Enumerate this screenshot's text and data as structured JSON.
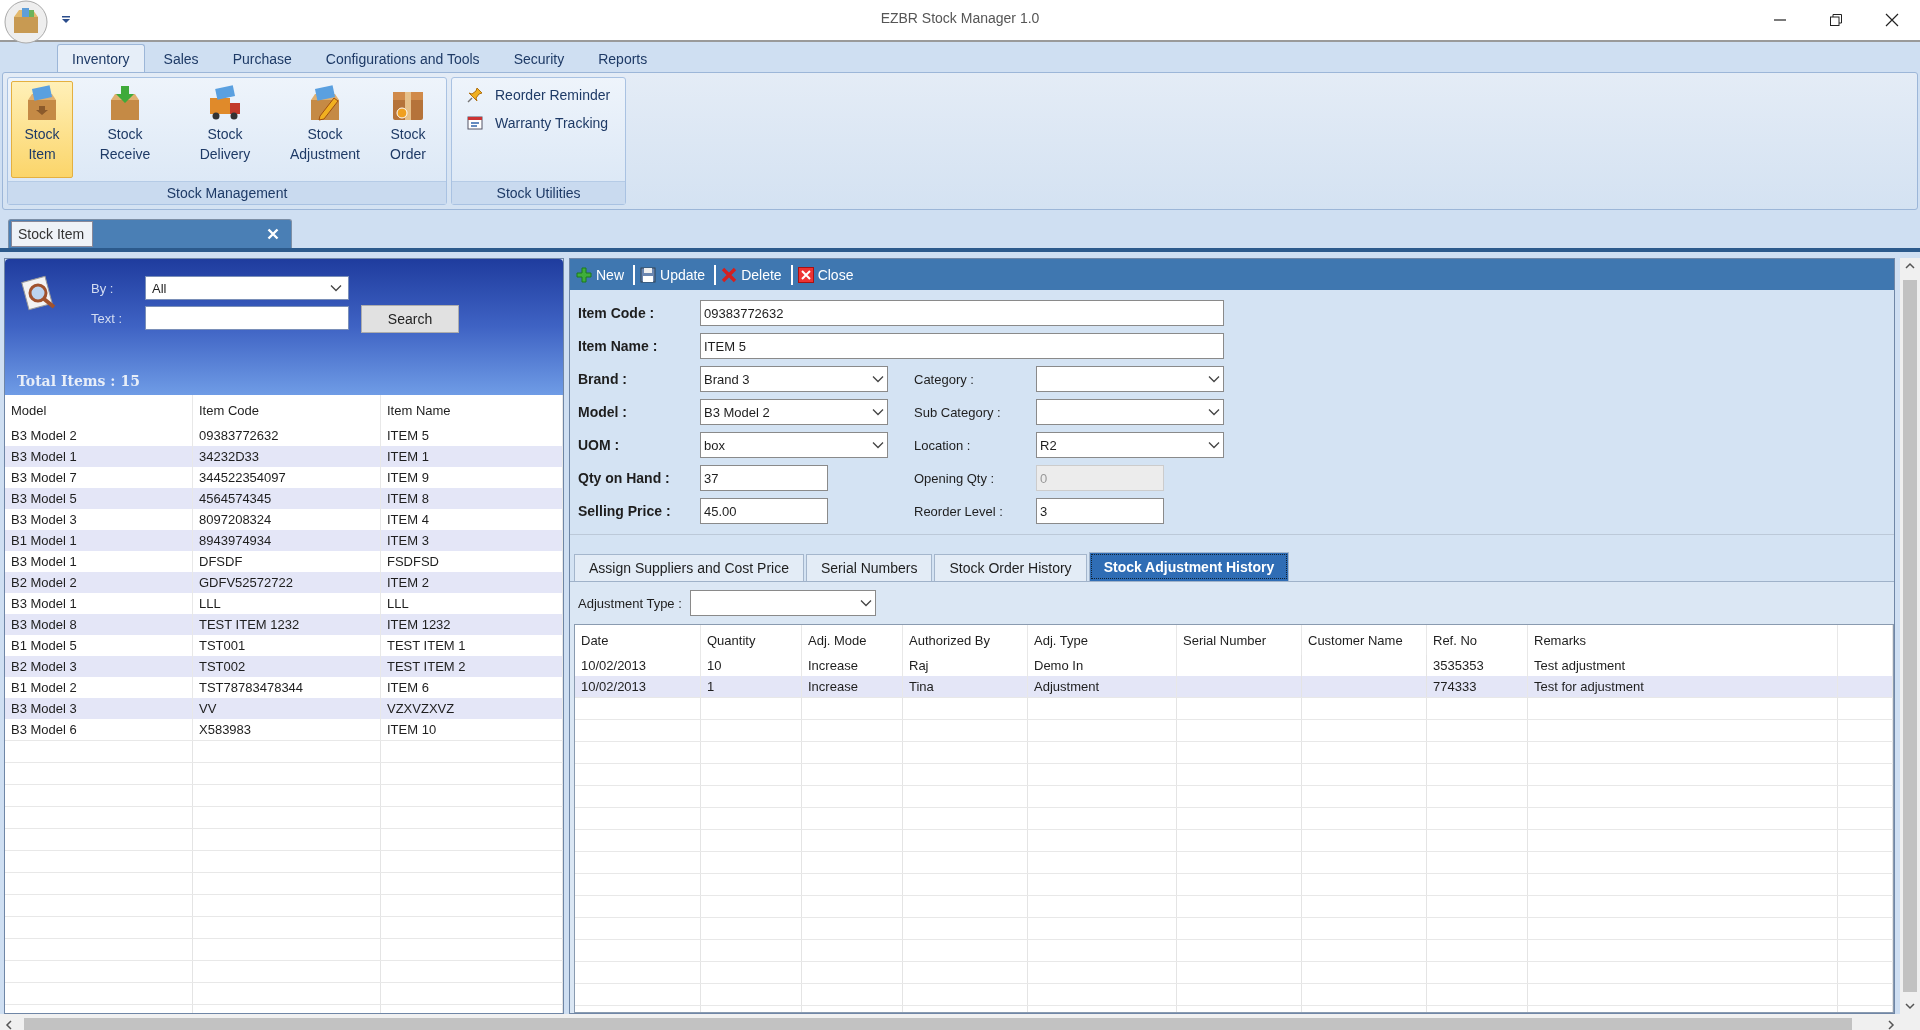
{
  "window": {
    "title": "EZBR Stock Manager 1.0"
  },
  "ribbon": {
    "tabs": [
      {
        "label": "Inventory",
        "selected": true
      },
      {
        "label": "Sales",
        "selected": false
      },
      {
        "label": "Purchase",
        "selected": false
      },
      {
        "label": "Configurations and Tools",
        "selected": false
      },
      {
        "label": "Security",
        "selected": false
      },
      {
        "label": "Reports",
        "selected": false
      }
    ],
    "groups": [
      {
        "title": "Stock Management",
        "kind": "large",
        "items": [
          {
            "label": "Stock Item",
            "selected": true
          },
          {
            "label": "Stock Receive",
            "selected": false
          },
          {
            "label": "Stock Delivery",
            "selected": false
          },
          {
            "label": "Stock Adjustment",
            "selected": false
          },
          {
            "label": "Stock Order",
            "selected": false
          }
        ]
      },
      {
        "title": "Stock Utilities",
        "kind": "small",
        "items": [
          {
            "label": "Reorder Reminder",
            "selected": false
          },
          {
            "label": "Warranty Tracking",
            "selected": false
          }
        ]
      }
    ]
  },
  "document_tabs": [
    {
      "label": "Stock Item",
      "selected": true
    }
  ],
  "search": {
    "by_label": "By :",
    "by_value": "All",
    "text_label": "Text :",
    "button": "Search",
    "total": "Total Items : 15"
  },
  "items_table": {
    "columns": [
      "Model",
      "Item Code",
      "Item Name"
    ],
    "rows": [
      [
        "B3 Model 2",
        "09383772632",
        "ITEM 5"
      ],
      [
        "B3 Model 1",
        "34232D33",
        "ITEM 1"
      ],
      [
        "B3 Model 7",
        "344522354097",
        "ITEM 9"
      ],
      [
        "B3 Model 5",
        "4564574345",
        "ITEM 8"
      ],
      [
        "B3 Model 3",
        "8097208324",
        "ITEM 4"
      ],
      [
        "B1 Model 1",
        "8943974934",
        "ITEM 3"
      ],
      [
        "B3 Model 1",
        "DFSDF",
        "FSDFSD"
      ],
      [
        "B2 Model 2",
        "GDFV52572722",
        "ITEM 2"
      ],
      [
        "B3 Model 1",
        "LLL",
        "LLL"
      ],
      [
        "B3 Model 8",
        "TEST ITEM 1232",
        "ITEM 1232"
      ],
      [
        "B1 Model 5",
        "TST001",
        "TEST ITEM 1"
      ],
      [
        "B2 Model 3",
        "TST002",
        "TEST ITEM 2"
      ],
      [
        "B1 Model 2",
        "TST78783478344",
        "ITEM 6"
      ],
      [
        "B3 Model 3",
        "VV",
        "VZXVZXVZ"
      ],
      [
        "B3 Model 6",
        "X583983",
        "ITEM 10"
      ]
    ]
  },
  "toolbar": [
    "New",
    "Update",
    "Delete",
    "Close"
  ],
  "form": {
    "rows": [
      [
        {
          "label": "Item Code :",
          "value": "09383772632",
          "kind": "text"
        }
      ],
      [
        {
          "label": "Item Name :",
          "value": "ITEM 5",
          "kind": "text"
        }
      ],
      [
        {
          "label": "Brand :",
          "value": "Brand 3",
          "kind": "combo"
        },
        {
          "label": "Category :",
          "kind": "combo"
        }
      ],
      [
        {
          "label": "Model :",
          "value": "B3 Model 2",
          "kind": "combo"
        },
        {
          "label": "Sub Category :",
          "kind": "combo"
        }
      ],
      [
        {
          "label": "UOM :",
          "value": "box",
          "kind": "combo"
        },
        {
          "label": "Location :",
          "value": "R2",
          "kind": "combo"
        }
      ],
      [
        {
          "label": "Qty on Hand :",
          "value": "37",
          "kind": "text"
        },
        {
          "label": "Opening Qty :",
          "value": "0",
          "kind": "text",
          "disabled": true
        }
      ],
      [
        {
          "label": "Selling Price :",
          "value": "45.00",
          "kind": "text"
        },
        {
          "label": "Reorder Level :",
          "value": "3",
          "kind": "text",
          "disabled": false
        }
      ]
    ]
  },
  "detail_tabs": [
    {
      "label": "Assign Suppliers and Cost Price",
      "selected": false
    },
    {
      "label": "Serial Numbers",
      "selected": false
    },
    {
      "label": "Stock Order History",
      "selected": false
    },
    {
      "label": "Stock Adjustment History",
      "selected": true
    }
  ],
  "adjustment_type": {
    "label": "Adjustment Type :"
  },
  "history_table": {
    "columns": [
      "Date",
      "Quantity",
      "Adj. Mode",
      "Authorized By",
      "Adj. Type",
      "Serial Number",
      "Customer Name",
      "Ref. No",
      "Remarks"
    ],
    "rows": [
      [
        "10/02/2013",
        "10",
        "Increase",
        "Raj",
        "Demo In",
        "",
        "",
        "3535353",
        "Test adjustment"
      ],
      [
        "10/02/2013",
        "1",
        "Increase",
        "Tina",
        "Adjustment",
        "",
        "",
        "774333",
        "Test for adjustment"
      ]
    ]
  }
}
